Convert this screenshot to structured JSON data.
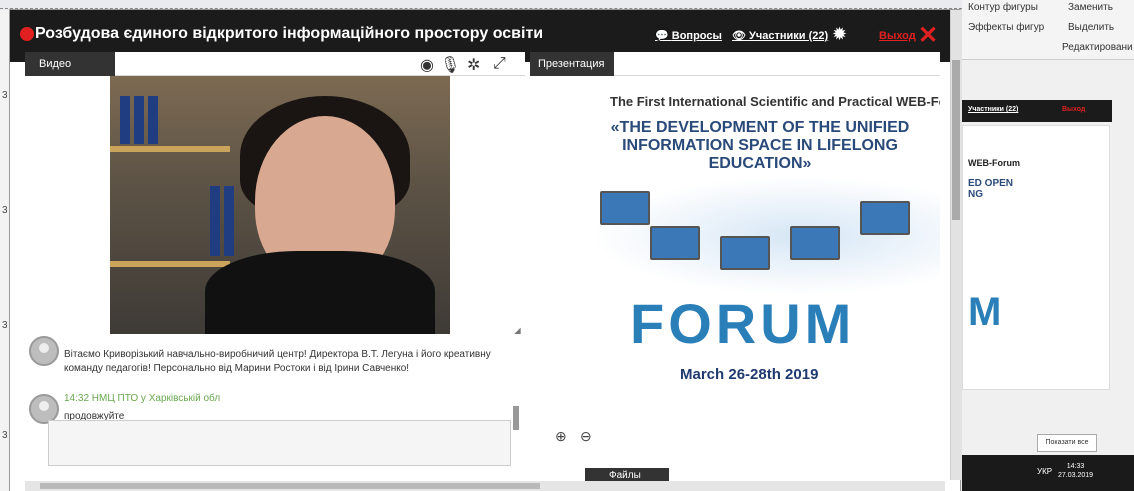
{
  "window": {
    "title": "Розбудова єдиного відкритого інформаційного простору освіти",
    "questions_label": "Вопросы",
    "participants_label": "Участники (22)",
    "exit_label": "Выход"
  },
  "panels": {
    "video_tab": "Видео",
    "presentation_tab": "Презентация",
    "files_tab": "Файлы"
  },
  "chat": {
    "messages": [
      {
        "text": "Вітаємо Криворізький навчально-виробничий центр! Директора В.Т. Легуна і його креативну команду педагогів! Персонально від Марини Ростоки і від Ірини Савченко!"
      },
      {
        "header": "14:32 НМЦ ПТО у Харківській обл",
        "text": "продовжуйте"
      }
    ]
  },
  "slide": {
    "subtitle": "The First International Scientific and Practical WEB-Forum",
    "title": "«THE DEVELOPMENT OF THE UNIFIED INFORMATION SPACE IN LIFELONG EDUCATION»",
    "forum_word": "FORUM",
    "dates": "March 26-28th 2019"
  },
  "background_app": {
    "ribbon_items": [
      "Контур фигуры",
      "Заменить",
      "Эффекты фигур",
      "Выделить",
      "Редактировани"
    ],
    "mini_participants": "Участники (22)",
    "mini_exit": "Выход",
    "mini_forum_line": "WEB-Forum",
    "mini_title": "ED OPEN NG",
    "mini_forum_letter": "M",
    "show_all": "Показати все",
    "taskbar_lang": "УКР",
    "taskbar_time": "14:33",
    "taskbar_date": "27.03.2019",
    "margin_numbers": [
      "3",
      "3",
      "3",
      "3"
    ]
  },
  "colors": {
    "titlebar": "#1b1b1b",
    "accent_red": "#e02020",
    "tab_dark": "#333333",
    "chat_header_green": "#6aa84f"
  }
}
